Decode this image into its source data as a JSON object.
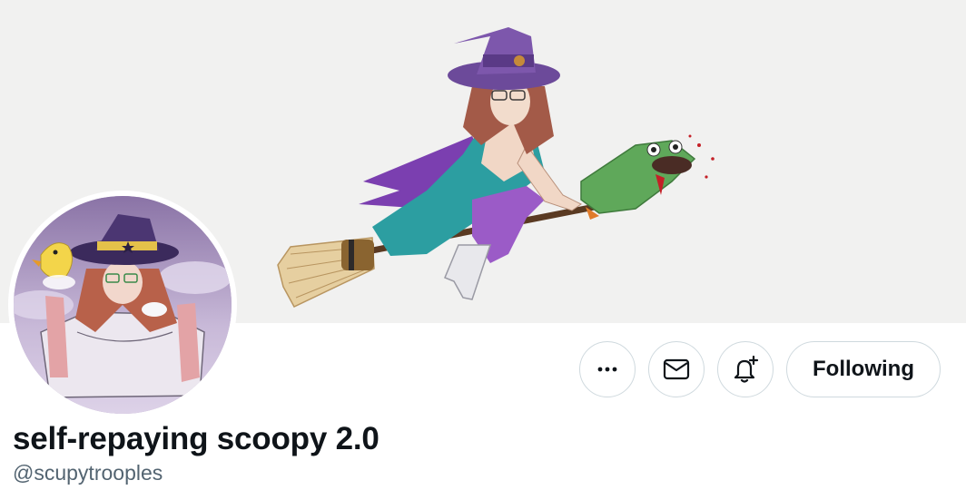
{
  "profile": {
    "display_name": "self-repaying scoopy 2.0",
    "handle": "@scupytrooples"
  },
  "actions": {
    "more_icon": "ellipsis-icon",
    "message_icon": "envelope-icon",
    "notify_icon": "bell-plus-icon",
    "following_label": "Following"
  },
  "colors": {
    "text_primary": "#0f1419",
    "text_secondary": "#536471",
    "border": "#cfd9de",
    "banner_bg": "#f1f1f0"
  }
}
